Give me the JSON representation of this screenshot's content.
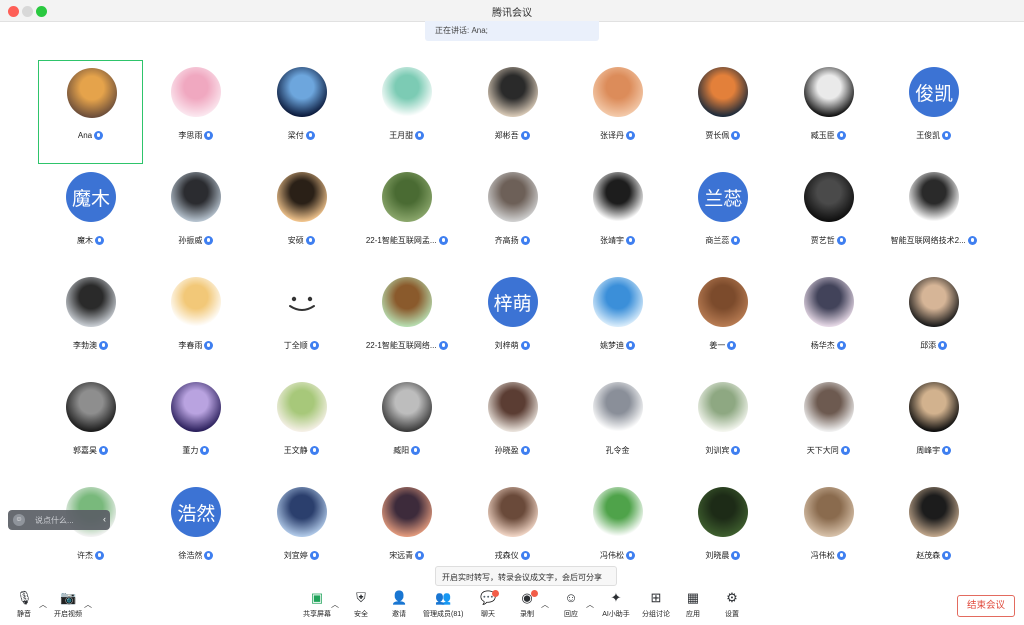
{
  "window": {
    "title": "腾讯会议"
  },
  "speaking": {
    "text": "正在讲话: Ana;"
  },
  "participants": [
    {
      "name": "Ana",
      "avatar": {
        "type": "photo",
        "colors": [
          "#6b4d3a",
          "#e5a34b"
        ]
      },
      "active": true
    },
    {
      "name": "李思雨",
      "avatar": {
        "type": "photo",
        "colors": [
          "#fbe7ef",
          "#f0a8c0"
        ]
      }
    },
    {
      "name": "梁付",
      "avatar": {
        "type": "photo",
        "colors": [
          "#0b1a3c",
          "#6da6dd"
        ]
      }
    },
    {
      "name": "王月甜",
      "avatar": {
        "type": "photo",
        "colors": [
          "#ffffff",
          "#7ccbb4"
        ]
      }
    },
    {
      "name": "郑彬吾",
      "avatar": {
        "type": "photo",
        "colors": [
          "#d8c9b6",
          "#2a2a2a"
        ]
      }
    },
    {
      "name": "张译丹",
      "avatar": {
        "type": "photo",
        "colors": [
          "#f3c9a9",
          "#dc8c5a"
        ]
      }
    },
    {
      "name": "贾长佩",
      "avatar": {
        "type": "photo",
        "colors": [
          "#1d2a3a",
          "#e3803a"
        ]
      }
    },
    {
      "name": "臧玉臣",
      "avatar": {
        "type": "photo",
        "colors": [
          "#111111",
          "#eaeaea"
        ]
      }
    },
    {
      "name": "王俊凯",
      "avatar": {
        "type": "text",
        "text": "俊凯"
      }
    },
    {
      "name": "魔木",
      "avatar": {
        "type": "text",
        "text": "魔木"
      }
    },
    {
      "name": "孙振威",
      "avatar": {
        "type": "photo",
        "colors": [
          "#b6c3cf",
          "#2b2c30"
        ]
      }
    },
    {
      "name": "安硕",
      "avatar": {
        "type": "photo",
        "colors": [
          "#f0c38c",
          "#2a2017"
        ]
      }
    },
    {
      "name": "22-1智能互联网孟...",
      "avatar": {
        "type": "photo",
        "colors": [
          "#8aa66b",
          "#4a6b33"
        ]
      }
    },
    {
      "name": "齐高扬",
      "avatar": {
        "type": "photo",
        "colors": [
          "#cfcfcf",
          "#6d6058"
        ]
      }
    },
    {
      "name": "张靖宇",
      "avatar": {
        "type": "photo",
        "colors": [
          "#ffffff",
          "#1d1d1d"
        ]
      }
    },
    {
      "name": "商兰蕊",
      "avatar": {
        "type": "text",
        "text": "兰蕊"
      }
    },
    {
      "name": "贾艺哲",
      "avatar": {
        "type": "photo",
        "colors": [
          "#0e0e0e",
          "#4a4a4a"
        ]
      }
    },
    {
      "name": "智能互联网络技术2...",
      "avatar": {
        "type": "photo",
        "colors": [
          "#ffffff",
          "#2a2a2a"
        ]
      }
    },
    {
      "name": "李勃澳",
      "avatar": {
        "type": "photo",
        "colors": [
          "#c7ccd2",
          "#2a2a2a"
        ]
      }
    },
    {
      "name": "李春雨",
      "avatar": {
        "type": "photo",
        "colors": [
          "#ffffff",
          "#f2c878"
        ]
      }
    },
    {
      "name": "丁全顺",
      "avatar": {
        "type": "smile"
      }
    },
    {
      "name": "22-1智能互联网络...",
      "avatar": {
        "type": "photo",
        "colors": [
          "#b7ddb0",
          "#8a5a2c"
        ]
      }
    },
    {
      "name": "刘梓萌",
      "avatar": {
        "type": "text",
        "text": "梓萌"
      }
    },
    {
      "name": "姚梦迪",
      "avatar": {
        "type": "photo",
        "colors": [
          "#d8ecfb",
          "#3b8fd9"
        ]
      }
    },
    {
      "name": "姜一",
      "avatar": {
        "type": "photo",
        "colors": [
          "#b77b52",
          "#7c4b2c"
        ]
      }
    },
    {
      "name": "杨华杰",
      "avatar": {
        "type": "photo",
        "colors": [
          "#e6d8e6",
          "#42435a"
        ]
      }
    },
    {
      "name": "邱添",
      "avatar": {
        "type": "photo",
        "colors": [
          "#1a1a1a",
          "#d6b597"
        ]
      }
    },
    {
      "name": "郭嘉昊",
      "avatar": {
        "type": "photo",
        "colors": [
          "#1b1b1b",
          "#8e8e8e"
        ]
      }
    },
    {
      "name": "董力",
      "avatar": {
        "type": "photo",
        "colors": [
          "#2a1f5b",
          "#b9a3e0"
        ]
      }
    },
    {
      "name": "王文静",
      "avatar": {
        "type": "photo",
        "colors": [
          "#f5f0e6",
          "#a7c87a"
        ]
      }
    },
    {
      "name": "臧阳",
      "avatar": {
        "type": "photo",
        "colors": [
          "#3a3a3a",
          "#bdbdbd"
        ]
      }
    },
    {
      "name": "孙晓盈",
      "avatar": {
        "type": "photo",
        "colors": [
          "#e9e2db",
          "#5b3d33"
        ]
      }
    },
    {
      "name": "孔令金",
      "avatar": {
        "type": "photo",
        "colors": [
          "#ffffff",
          "#8a8f99"
        ]
      },
      "no_mic": true
    },
    {
      "name": "刘训宾",
      "avatar": {
        "type": "photo",
        "colors": [
          "#f4f6ef",
          "#8ea882"
        ]
      }
    },
    {
      "name": "天下大同",
      "avatar": {
        "type": "photo",
        "colors": [
          "#f0f0f0",
          "#6d5a50"
        ]
      }
    },
    {
      "name": "周峰宇",
      "avatar": {
        "type": "photo",
        "colors": [
          "#0d0d0d",
          "#d2b28e"
        ]
      }
    },
    {
      "name": "许杰",
      "avatar": {
        "type": "photo",
        "colors": [
          "#f2f2f2",
          "#79b97c"
        ]
      }
    },
    {
      "name": "徐浩然",
      "avatar": {
        "type": "text",
        "text": "浩然"
      }
    },
    {
      "name": "刘宜婷",
      "avatar": {
        "type": "photo",
        "colors": [
          "#b0c9e8",
          "#2b3f6d"
        ]
      }
    },
    {
      "name": "宋远青",
      "avatar": {
        "type": "photo",
        "colors": [
          "#e29a7d",
          "#3d2b3b"
        ]
      }
    },
    {
      "name": "戎森仪",
      "avatar": {
        "type": "photo",
        "colors": [
          "#f0d4c4",
          "#6a4a3a"
        ]
      }
    },
    {
      "name": "冯伟松",
      "avatar": {
        "type": "photo",
        "colors": [
          "#ffffff",
          "#4fa34a"
        ]
      }
    },
    {
      "name": "刘晓晨",
      "avatar": {
        "type": "photo",
        "colors": [
          "#3e5e2e",
          "#1d2b17"
        ]
      }
    },
    {
      "name": "冯伟松",
      "avatar": {
        "type": "photo",
        "colors": [
          "#d6c0a8",
          "#8a6b4e"
        ]
      }
    },
    {
      "name": "赵茂森",
      "avatar": {
        "type": "photo",
        "colors": [
          "#bfa58a",
          "#1c1c1c"
        ]
      }
    }
  ],
  "chat": {
    "placeholder": "说点什么..."
  },
  "tip": {
    "text": "开启实时转写，转录会议成文字，会后可分享"
  },
  "toolbar": {
    "mute": "静音",
    "video": "开启视频",
    "share": "共享屏幕",
    "security": "安全",
    "invite": "邀请",
    "members": "管理成员(81)",
    "chat": "聊天",
    "record": "录制",
    "react": "回应",
    "ai": "AI小助手",
    "breakout": "分组讨论",
    "apps": "应用",
    "settings": "设置",
    "end": "结束会议"
  }
}
